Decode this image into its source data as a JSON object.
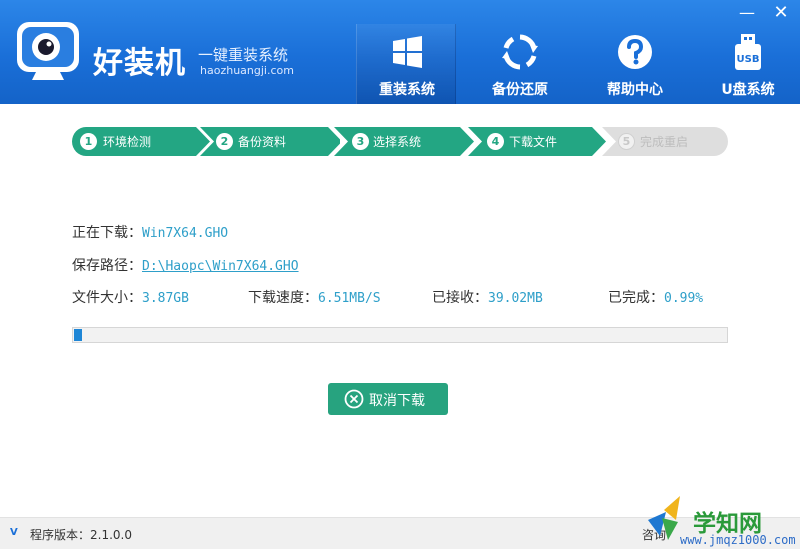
{
  "brand": {
    "name": "好装机",
    "slogan": "一键重装系统",
    "url": "haozhuangji.com"
  },
  "window": {
    "minimize": "—",
    "close": "✕"
  },
  "nav": [
    {
      "label": "重装系统",
      "icon": "windows-icon"
    },
    {
      "label": "备份还原",
      "icon": "refresh-icon"
    },
    {
      "label": "帮助中心",
      "icon": "help-icon"
    },
    {
      "label": "U盘系统",
      "icon": "usb-icon",
      "icon_text": "USB"
    }
  ],
  "steps": [
    {
      "num": "1",
      "label": "环境检测",
      "state": "done"
    },
    {
      "num": "2",
      "label": "备份资料",
      "state": "done"
    },
    {
      "num": "3",
      "label": "选择系统",
      "state": "done"
    },
    {
      "num": "4",
      "label": "下载文件",
      "state": "active"
    },
    {
      "num": "5",
      "label": "完成重启",
      "state": "pending"
    }
  ],
  "download": {
    "downloading_label": "正在下载：",
    "downloading_value": "Win7X64.GHO",
    "path_label": "保存路径：",
    "path_value": "D:\\Haopc\\Win7X64.GHO",
    "size_label": "文件大小：",
    "size_value": "3.87GB",
    "speed_label": "下载速度：",
    "speed_value": "6.51MB/S",
    "received_label": "已接收：",
    "received_value": "39.02MB",
    "done_label": "已完成：",
    "done_value": "0.99%",
    "progress_fraction": 0.0099
  },
  "cancel_button": {
    "label": "取消下载"
  },
  "footer": {
    "v_badge": "V",
    "version": "程序版本：2.1.0.0",
    "consult": "咨询"
  },
  "watermark": {
    "text": "学知网",
    "url": "www.jmqz1000.com"
  },
  "colors": {
    "header": "#1a6fd8",
    "step_active": "#23a683",
    "step_inactive": "#dedede",
    "link": "#2e9fc9",
    "button": "#27a37f",
    "progress": "#1e86d6"
  }
}
